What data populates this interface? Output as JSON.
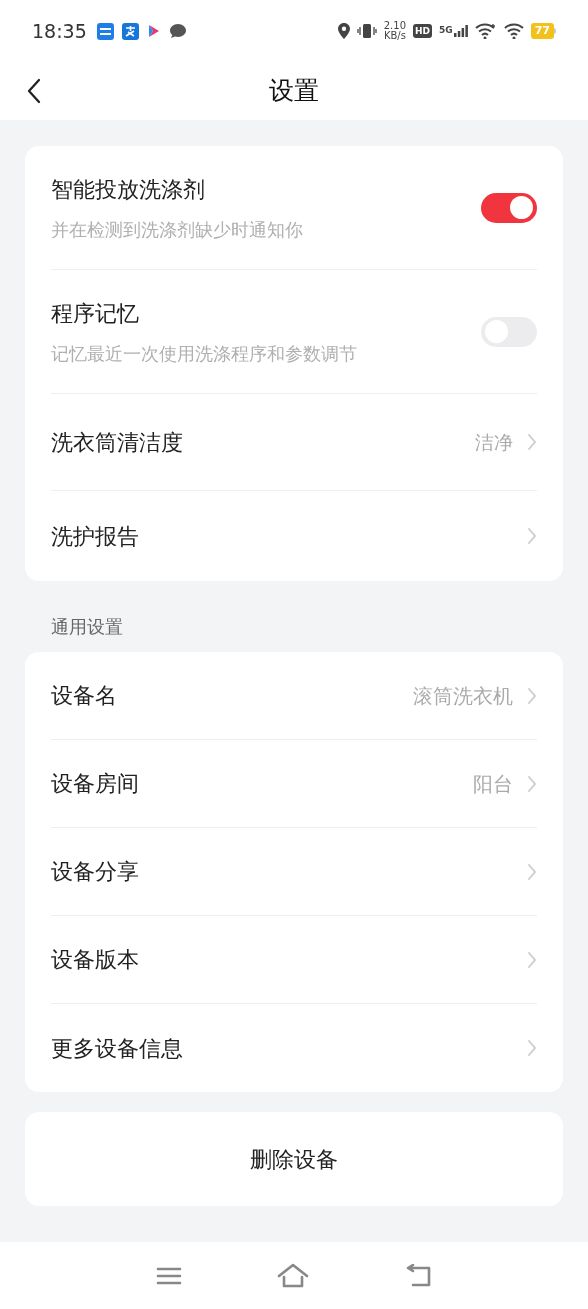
{
  "status_bar": {
    "time": "18:35",
    "speed_value": "2.10",
    "speed_unit": "KB/s",
    "hd": "HD",
    "network": "5G",
    "battery": "77"
  },
  "header": {
    "title": "设置"
  },
  "main_card": [
    {
      "kind": "toggle",
      "label": "智能投放洗涤剂",
      "description": "并在检测到洗涤剂缺少时通知你",
      "on": true
    },
    {
      "kind": "toggle",
      "label": "程序记忆",
      "description": "记忆最近一次使用洗涤程序和参数调节",
      "on": false
    },
    {
      "kind": "link",
      "label": "洗衣筒清洁度",
      "value": "洁净"
    },
    {
      "kind": "link",
      "label": "洗护报告"
    }
  ],
  "general_section": {
    "title": "通用设置",
    "items": [
      {
        "label": "设备名",
        "value": "滚筒洗衣机"
      },
      {
        "label": "设备房间",
        "value": "阳台"
      },
      {
        "label": "设备分享"
      },
      {
        "label": "设备版本"
      },
      {
        "label": "更多设备信息"
      }
    ]
  },
  "delete_button": "删除设备"
}
